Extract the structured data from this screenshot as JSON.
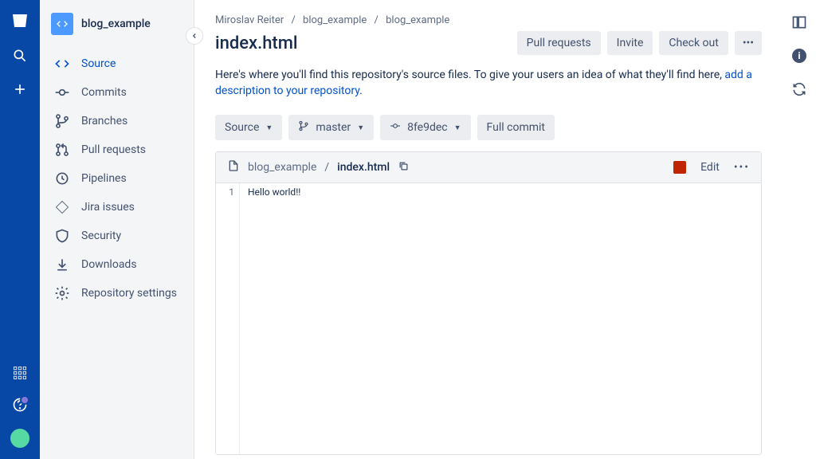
{
  "breadcrumbs": [
    "Miroslav Reiter",
    "blog_example",
    "blog_example"
  ],
  "page_title": "index.html",
  "header_actions": {
    "pull_requests": "Pull requests",
    "invite": "Invite",
    "check_out": "Check out"
  },
  "description": {
    "text": "Here's where you'll find this repository's source files. To give your users an idea of what they'll find here, ",
    "link": "add a description to your repository",
    "suffix": "."
  },
  "toolbar": {
    "source": "Source",
    "branch": "master",
    "commit": "8fe9dec",
    "full_commit": "Full commit"
  },
  "file_panel": {
    "dir": "blog_example",
    "filename": "index.html",
    "edit_label": "Edit",
    "line_number": "1",
    "code_line": "Hello world!!"
  },
  "sidebar": {
    "repo_name": "blog_example",
    "items": [
      {
        "label": "Source"
      },
      {
        "label": "Commits"
      },
      {
        "label": "Branches"
      },
      {
        "label": "Pull requests"
      },
      {
        "label": "Pipelines"
      },
      {
        "label": "Jira issues"
      },
      {
        "label": "Security"
      },
      {
        "label": "Downloads"
      },
      {
        "label": "Repository settings"
      }
    ]
  }
}
